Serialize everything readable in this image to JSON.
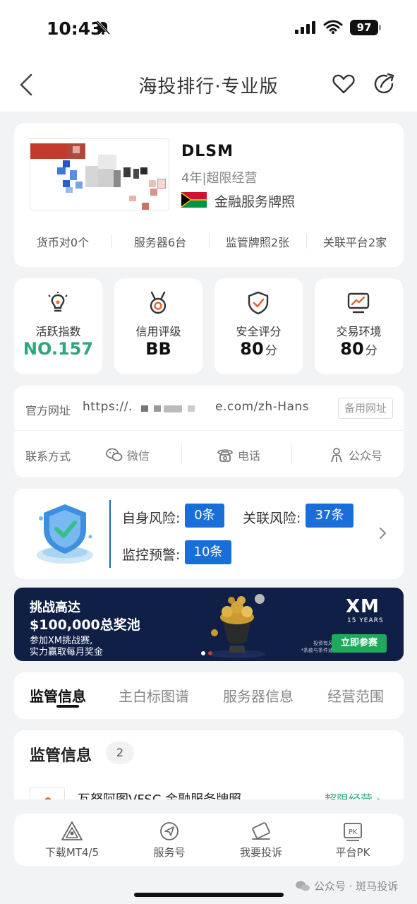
{
  "status_bar": {
    "time": "10:43",
    "battery": "97"
  },
  "nav": {
    "title": "海投排行·专业版"
  },
  "profile": {
    "name": "DLSM",
    "years": "4年|超限经营",
    "license": "金融服务牌照",
    "stats": [
      "货币对0个",
      "服务器6台",
      "监管牌照2张",
      "关联平台2家"
    ]
  },
  "metrics": [
    {
      "label": "活跃指数",
      "value": "NO.157",
      "unit": "",
      "icon": "bulb-icon"
    },
    {
      "label": "信用评级",
      "value": "BB",
      "unit": "",
      "icon": "medal-icon"
    },
    {
      "label": "安全评分",
      "value": "80",
      "unit": "分",
      "icon": "shield-check-icon"
    },
    {
      "label": "交易环境",
      "value": "80",
      "unit": "分",
      "icon": "monitor-chart-icon"
    }
  ],
  "website": {
    "label": "官方网址",
    "url_start": "https://.",
    "url_end": "e.com/zh-Hans",
    "backup_label": "备用网址"
  },
  "contact": {
    "label": "联系方式",
    "wechat": "微信",
    "phone": "电话",
    "official": "公众号"
  },
  "risk": {
    "self_label": "自身风险:",
    "self_value": "0条",
    "related_label": "关联风险:",
    "related_value": "37条",
    "monitor_label": "监控预警:",
    "monitor_value": "10条"
  },
  "banner": {
    "line1": "挑战高达",
    "line2": "$100,000总奖池",
    "line3": "参加XM挑战赛,",
    "line4": "实力赢取每月奖金",
    "logo": "XM",
    "years": "15 YEARS",
    "disclaimer1": "投资有风险。",
    "disclaimer2": "*条款与条件适用。",
    "cta": "立即参赛"
  },
  "tabs": [
    "监管信息",
    "主白标图谱",
    "服务器信息",
    "经营范围"
  ],
  "regulation": {
    "title": "监管信息",
    "count": "2",
    "item_text": "瓦努阿图VFSC 金融服务牌照",
    "item_status": "超限经营 ›"
  },
  "bottom_bar": [
    "下载MT4/5",
    "服务号",
    "我要投诉",
    "平台PK"
  ],
  "watermark": "公众号 · 斑马投诉",
  "colors": {
    "accent_green": "#2ca67a",
    "accent_blue": "#1a6ed8",
    "banner_bg": "#0f1f45"
  }
}
